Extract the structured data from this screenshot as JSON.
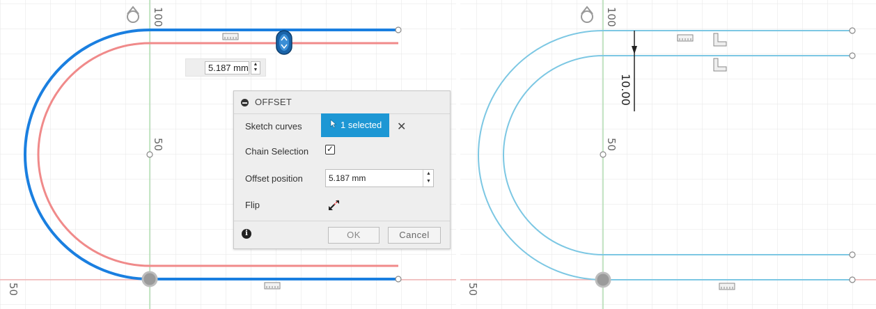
{
  "axis_labels": {
    "left_top": "100",
    "left_mid": "50",
    "left_bottom": "50",
    "right_top": "100",
    "right_mid": "50",
    "right_bottom": "50"
  },
  "inline_input": {
    "value": "5.187 mm"
  },
  "dimension": {
    "value": "10.00"
  },
  "dialog": {
    "title": "OFFSET",
    "sketch_curves_label": "Sketch curves",
    "selected_button": "1 selected",
    "chain_selection_label": "Chain Selection",
    "chain_selection_checked": true,
    "offset_position_label": "Offset position",
    "offset_position_value": "5.187 mm",
    "flip_label": "Flip",
    "ok_label": "OK",
    "cancel_label": "Cancel"
  },
  "icons": {
    "clear": "close-icon",
    "info": "info-icon",
    "flip": "flip-icon",
    "checkbox_mark": "✓",
    "clear_glyph": "✕",
    "info_glyph": "i"
  },
  "colors": {
    "selected_curve": "#1a7fe0",
    "offset_preview": "#f08a8a",
    "finished_curve": "#7cc7e3",
    "x_axis": "#f0a0a0",
    "y_axis": "#8fd08f",
    "grid": "#e3e3e3",
    "accent_button": "#1d97d4"
  }
}
